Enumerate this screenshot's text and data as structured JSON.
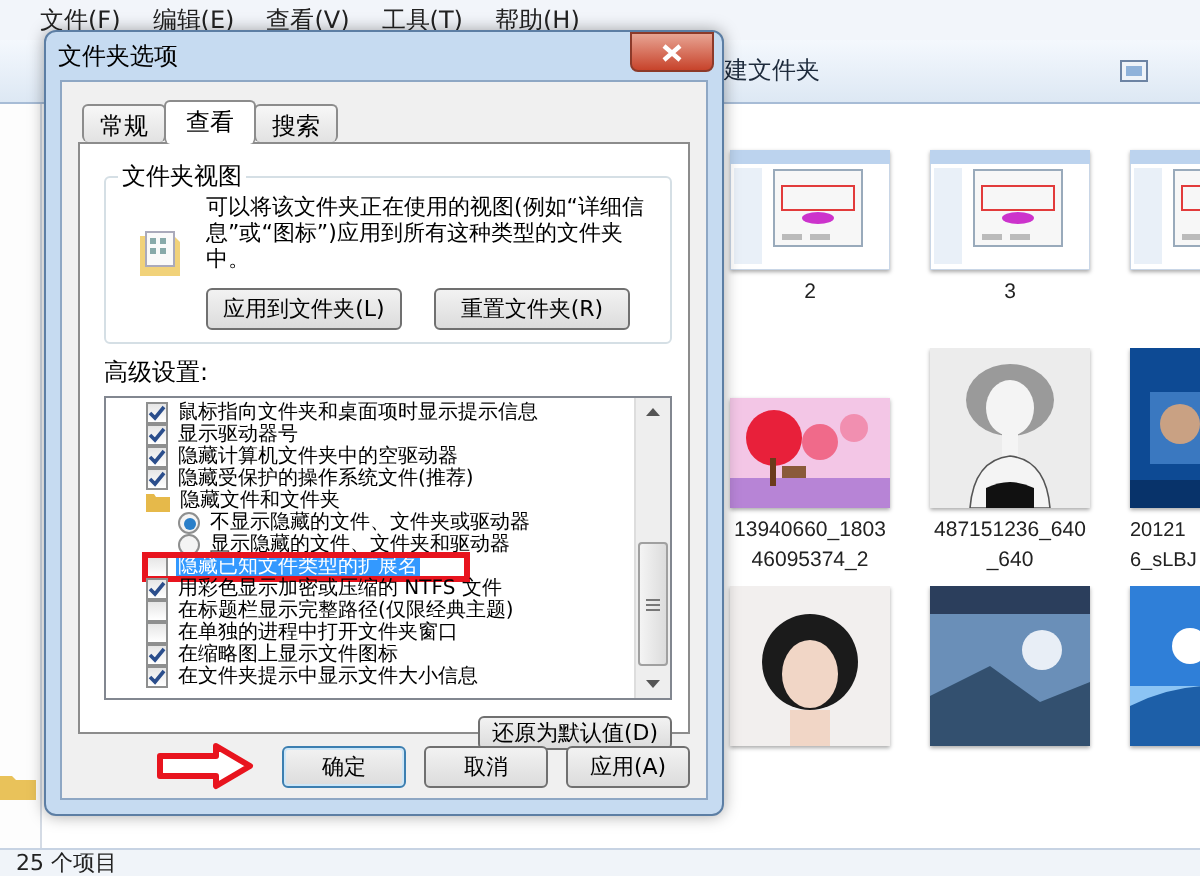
{
  "explorer": {
    "menu": [
      "文件(F)",
      "编辑(E)",
      "查看(V)",
      "工具(T)",
      "帮助(H)"
    ],
    "toolbar": {
      "new_folder": "建文件夹"
    },
    "files": [
      {
        "kind": "screenshot",
        "label_lines": [
          "2"
        ]
      },
      {
        "kind": "screenshot",
        "label_lines": [
          "3"
        ]
      },
      {
        "kind": "screenshot"
      },
      {
        "kind": "picture",
        "label_lines": [
          "13940660_1803",
          "46095374_2"
        ]
      },
      {
        "kind": "picture",
        "label_lines": [
          "487151236_640",
          "_640"
        ]
      },
      {
        "kind": "picture",
        "label_lines": [
          "20121",
          "6_sLBJ"
        ]
      },
      {
        "kind": "picture"
      },
      {
        "kind": "picture"
      },
      {
        "kind": "picture"
      }
    ],
    "status_bar": "25 个项目"
  },
  "dialog": {
    "title": "文件夹选项",
    "tabs": [
      {
        "label": "常规",
        "selected": false
      },
      {
        "label": "查看",
        "selected": true
      },
      {
        "label": "搜索",
        "selected": false
      }
    ],
    "folder_views": {
      "title": "文件夹视图",
      "description": "可以将该文件夹正在使用的视图(例如“详细信息”或“图标”)应用到所有这种类型的文件夹中。",
      "buttons": [
        "应用到文件夹(L)",
        "重置文件夹(R)"
      ]
    },
    "advanced": {
      "label": "高级设置:",
      "items": [
        {
          "kind": "checkbox",
          "label": "鼠标指向文件夹和桌面项时显示提示信息",
          "checked": true,
          "selected": false,
          "outlined": false
        },
        {
          "kind": "checkbox",
          "label": "显示驱动器号",
          "checked": true,
          "selected": false,
          "outlined": false
        },
        {
          "kind": "checkbox",
          "label": "隐藏计算机文件夹中的空驱动器",
          "checked": true,
          "selected": false,
          "outlined": false
        },
        {
          "kind": "checkbox",
          "label": "隐藏受保护的操作系统文件(推荐)",
          "checked": true,
          "selected": false,
          "outlined": false
        },
        {
          "kind": "folder",
          "label": "隐藏文件和文件夹",
          "selected": false,
          "outlined": false,
          "children": [
            {
              "kind": "radio",
              "label": "不显示隐藏的文件、文件夹或驱动器",
              "selected": true
            },
            {
              "kind": "radio",
              "label": "显示隐藏的文件、文件夹和驱动器",
              "selected": false
            }
          ]
        },
        {
          "kind": "checkbox",
          "label": "隐藏已知文件类型的扩展名",
          "checked": false,
          "selected": true,
          "outlined": true
        },
        {
          "kind": "checkbox",
          "label": "用彩色显示加密或压缩的 NTFS 文件",
          "checked": true,
          "selected": false,
          "outlined": false
        },
        {
          "kind": "checkbox",
          "label": "在标题栏显示完整路径(仅限经典主题)",
          "checked": false,
          "selected": false,
          "outlined": false
        },
        {
          "kind": "checkbox",
          "label": "在单独的进程中打开文件夹窗口",
          "checked": false,
          "selected": false,
          "outlined": false
        },
        {
          "kind": "checkbox",
          "label": "在缩略图上显示文件图标",
          "checked": true,
          "selected": false,
          "outlined": false
        },
        {
          "kind": "checkbox",
          "label": "在文件夹提示中显示文件大小信息",
          "checked": true,
          "selected": false,
          "outlined": false
        }
      ]
    },
    "restore_button": "还原为默认值(D)",
    "buttons": [
      "确定",
      "取消",
      "应用(A)"
    ]
  }
}
